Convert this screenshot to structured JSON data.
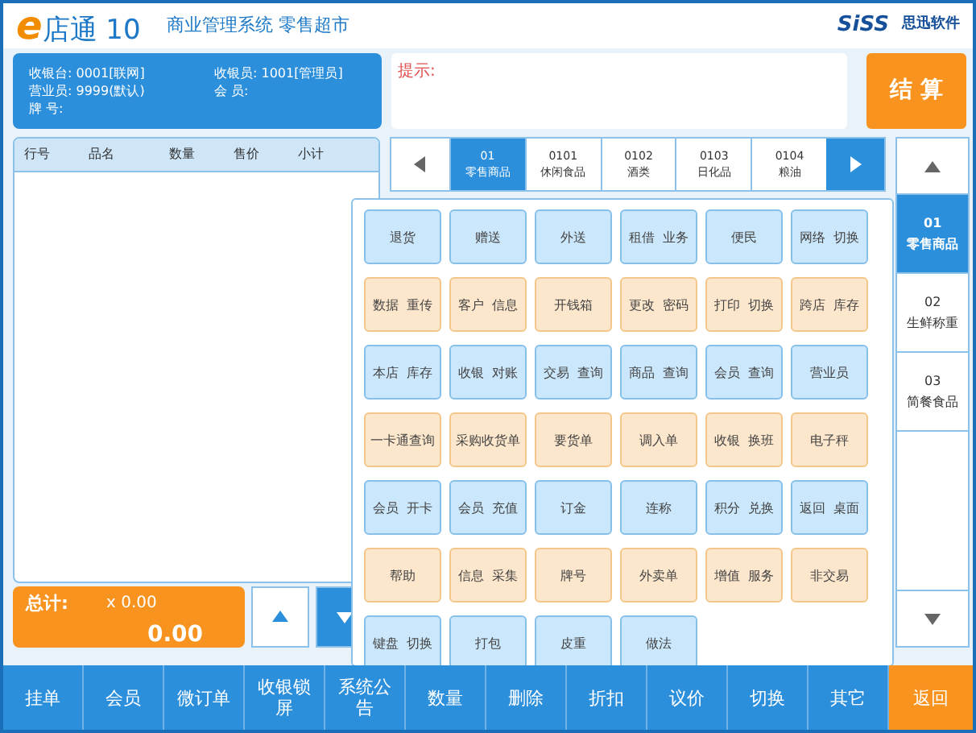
{
  "header": {
    "logo_mark": "e",
    "logo_text": "店通 10",
    "subtitle": "商业管理系统  零售超市",
    "brand": "SiSS",
    "brand_cn": "思迅软件"
  },
  "info": {
    "cashier_desk": "收银台: 0001[联网]",
    "cashier": "收银员: 1001[管理员]",
    "salesperson": "营业员: 9999(默认)",
    "member": "会   员:",
    "tag": "牌   号:"
  },
  "hint": {
    "label": "提示:"
  },
  "checkout_button": "结 算",
  "table": {
    "columns": [
      "行号",
      "品名",
      "数量",
      "售价",
      "小计"
    ]
  },
  "total": {
    "label": "总计:",
    "quantity": "x 0.00",
    "amount": "0.00"
  },
  "categories": [
    {
      "code": "01",
      "name": "零售商品",
      "selected": true
    },
    {
      "code": "0101",
      "name": "休闲食品",
      "selected": false
    },
    {
      "code": "0102",
      "name": "酒类",
      "selected": false
    },
    {
      "code": "0103",
      "name": "日化品",
      "selected": false
    },
    {
      "code": "0104",
      "name": "粮油",
      "selected": false
    }
  ],
  "side_categories": [
    {
      "code": "01",
      "name": "零售商品",
      "selected": true
    },
    {
      "code": "02",
      "name": "生鲜称重",
      "selected": false
    },
    {
      "code": "03",
      "name": "简餐食品",
      "selected": false
    }
  ],
  "function_rows": [
    {
      "kind": "blue",
      "buttons": [
        "退货",
        "赠送",
        "外送",
        "租借  业务",
        "便民",
        "网络  切换"
      ]
    },
    {
      "kind": "orange",
      "buttons": [
        "数据  重传",
        "客户  信息",
        "开钱箱",
        "更改  密码",
        "打印  切换",
        "跨店  库存"
      ]
    },
    {
      "kind": "blue",
      "buttons": [
        "本店  库存",
        "收银  对账",
        "交易  查询",
        "商品  查询",
        "会员  查询",
        "营业员"
      ]
    },
    {
      "kind": "orange",
      "buttons": [
        "一卡通查询",
        "采购收货单",
        "要货单",
        "调入单",
        "收银  换班",
        "电子秤"
      ]
    },
    {
      "kind": "blue",
      "buttons": [
        "会员  开卡",
        "会员  充值",
        "订金",
        "连称",
        "积分  兑换",
        "返回  桌面"
      ]
    },
    {
      "kind": "orange",
      "buttons": [
        "帮助",
        "信息  采集",
        "牌号",
        "外卖单",
        "增值  服务",
        "非交易"
      ]
    },
    {
      "kind": "blue",
      "buttons": [
        "键盘  切换",
        "打包",
        "皮重",
        "做法"
      ]
    }
  ],
  "bottom_bar": [
    {
      "label": "挂单",
      "kind": "normal"
    },
    {
      "label": "会员",
      "kind": "normal"
    },
    {
      "label": "微订单",
      "kind": "normal"
    },
    {
      "label": "收银锁屏",
      "kind": "normal"
    },
    {
      "label": "系统公告",
      "kind": "normal"
    },
    {
      "label": "数量",
      "kind": "normal"
    },
    {
      "label": "删除",
      "kind": "normal"
    },
    {
      "label": "折扣",
      "kind": "normal"
    },
    {
      "label": "议价",
      "kind": "normal"
    },
    {
      "label": "切换",
      "kind": "normal"
    },
    {
      "label": "其它",
      "kind": "normal"
    },
    {
      "label": "返回",
      "kind": "accent"
    }
  ]
}
